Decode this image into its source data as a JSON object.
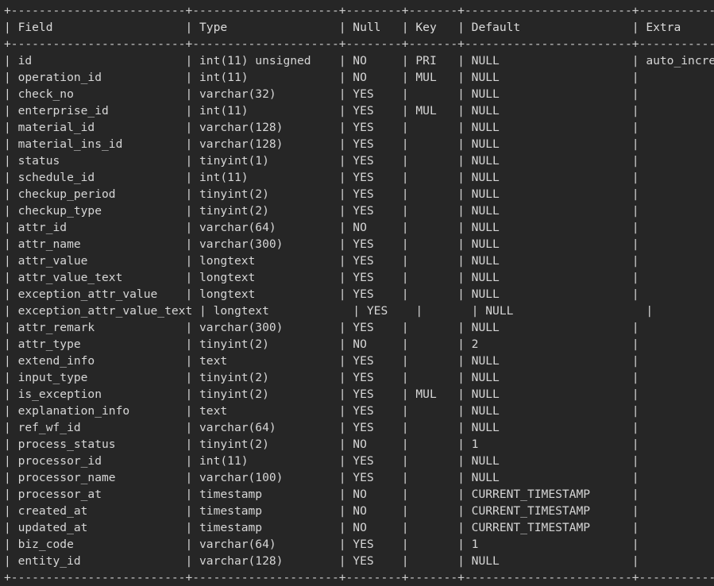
{
  "terminal": {
    "app": "mysql-client-terminal",
    "background_color": "#262626",
    "foreground_color": "#d6d6d6",
    "command_kind": "describe-table",
    "columns": [
      {
        "name": "Field",
        "width": 23
      },
      {
        "name": "Type",
        "width": 19
      },
      {
        "name": "Null",
        "width": 6
      },
      {
        "name": "Key",
        "width": 5
      },
      {
        "name": "Default",
        "width": 22
      },
      {
        "name": "Extra",
        "width": 16
      }
    ],
    "rows": [
      {
        "field": "id",
        "type": "int(11) unsigned",
        "null": "NO",
        "key": "PRI",
        "default": "NULL",
        "extra": "auto_increment"
      },
      {
        "field": "operation_id",
        "type": "int(11)",
        "null": "NO",
        "key": "MUL",
        "default": "NULL",
        "extra": ""
      },
      {
        "field": "check_no",
        "type": "varchar(32)",
        "null": "YES",
        "key": "",
        "default": "NULL",
        "extra": ""
      },
      {
        "field": "enterprise_id",
        "type": "int(11)",
        "null": "YES",
        "key": "MUL",
        "default": "NULL",
        "extra": ""
      },
      {
        "field": "material_id",
        "type": "varchar(128)",
        "null": "YES",
        "key": "",
        "default": "NULL",
        "extra": ""
      },
      {
        "field": "material_ins_id",
        "type": "varchar(128)",
        "null": "YES",
        "key": "",
        "default": "NULL",
        "extra": ""
      },
      {
        "field": "status",
        "type": "tinyint(1)",
        "null": "YES",
        "key": "",
        "default": "NULL",
        "extra": ""
      },
      {
        "field": "schedule_id",
        "type": "int(11)",
        "null": "YES",
        "key": "",
        "default": "NULL",
        "extra": ""
      },
      {
        "field": "checkup_period",
        "type": "tinyint(2)",
        "null": "YES",
        "key": "",
        "default": "NULL",
        "extra": ""
      },
      {
        "field": "checkup_type",
        "type": "tinyint(2)",
        "null": "YES",
        "key": "",
        "default": "NULL",
        "extra": ""
      },
      {
        "field": "attr_id",
        "type": "varchar(64)",
        "null": "NO",
        "key": "",
        "default": "NULL",
        "extra": ""
      },
      {
        "field": "attr_name",
        "type": "varchar(300)",
        "null": "YES",
        "key": "",
        "default": "NULL",
        "extra": ""
      },
      {
        "field": "attr_value",
        "type": "longtext",
        "null": "YES",
        "key": "",
        "default": "NULL",
        "extra": ""
      },
      {
        "field": "attr_value_text",
        "type": "longtext",
        "null": "YES",
        "key": "",
        "default": "NULL",
        "extra": ""
      },
      {
        "field": "exception_attr_value",
        "type": "longtext",
        "null": "YES",
        "key": "",
        "default": "NULL",
        "extra": ""
      },
      {
        "field": "exception_attr_value_text",
        "type": "longtext",
        "null": "YES",
        "key": "",
        "default": "NULL",
        "extra": ""
      },
      {
        "field": "attr_remark",
        "type": "varchar(300)",
        "null": "YES",
        "key": "",
        "default": "NULL",
        "extra": ""
      },
      {
        "field": "attr_type",
        "type": "tinyint(2)",
        "null": "NO",
        "key": "",
        "default": "2",
        "extra": ""
      },
      {
        "field": "extend_info",
        "type": "text",
        "null": "YES",
        "key": "",
        "default": "NULL",
        "extra": ""
      },
      {
        "field": "input_type",
        "type": "tinyint(2)",
        "null": "YES",
        "key": "",
        "default": "NULL",
        "extra": ""
      },
      {
        "field": "is_exception",
        "type": "tinyint(2)",
        "null": "YES",
        "key": "MUL",
        "default": "NULL",
        "extra": ""
      },
      {
        "field": "explanation_info",
        "type": "text",
        "null": "YES",
        "key": "",
        "default": "NULL",
        "extra": ""
      },
      {
        "field": "ref_wf_id",
        "type": "varchar(64)",
        "null": "YES",
        "key": "",
        "default": "NULL",
        "extra": ""
      },
      {
        "field": "process_status",
        "type": "tinyint(2)",
        "null": "NO",
        "key": "",
        "default": "1",
        "extra": ""
      },
      {
        "field": "processor_id",
        "type": "int(11)",
        "null": "YES",
        "key": "",
        "default": "NULL",
        "extra": ""
      },
      {
        "field": "processor_name",
        "type": "varchar(100)",
        "null": "YES",
        "key": "",
        "default": "NULL",
        "extra": ""
      },
      {
        "field": "processor_at",
        "type": "timestamp",
        "null": "NO",
        "key": "",
        "default": "CURRENT_TIMESTAMP",
        "extra": ""
      },
      {
        "field": "created_at",
        "type": "timestamp",
        "null": "NO",
        "key": "",
        "default": "CURRENT_TIMESTAMP",
        "extra": ""
      },
      {
        "field": "updated_at",
        "type": "timestamp",
        "null": "NO",
        "key": "",
        "default": "CURRENT_TIMESTAMP",
        "extra": ""
      },
      {
        "field": "biz_code",
        "type": "varchar(64)",
        "null": "YES",
        "key": "",
        "default": "1",
        "extra": ""
      },
      {
        "field": "entity_id",
        "type": "varchar(128)",
        "null": "YES",
        "key": "",
        "default": "NULL",
        "extra": ""
      }
    ]
  }
}
